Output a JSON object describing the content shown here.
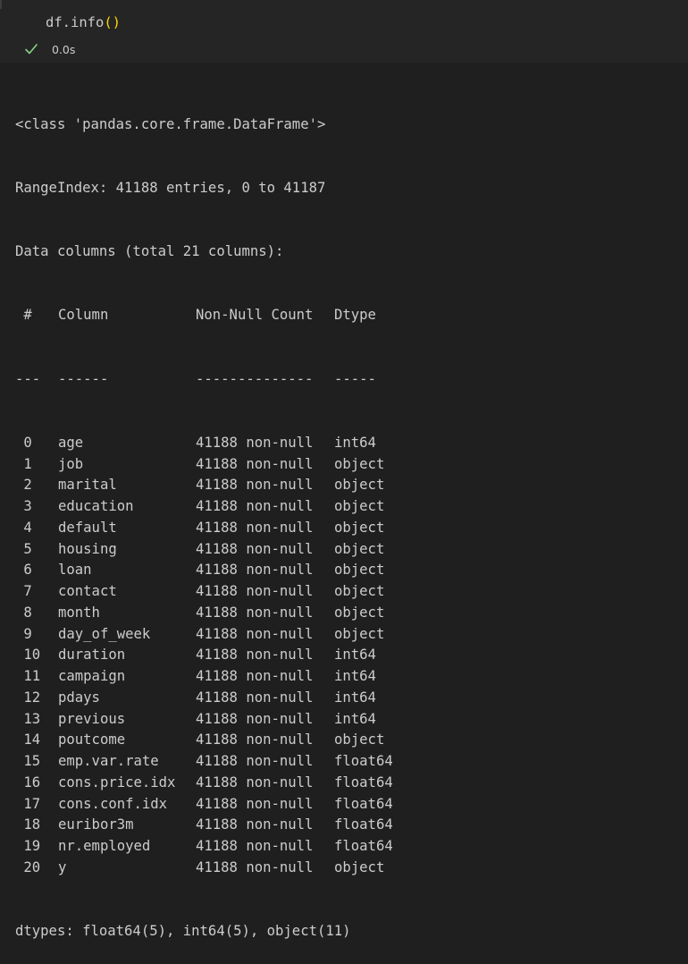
{
  "cell": {
    "code_prefix": "df.info",
    "code_parens": "()",
    "status_icon": "check-icon",
    "status_color": "#89d185",
    "exec_time": "0.0s"
  },
  "output": {
    "class_line": "<class 'pandas.core.frame.DataFrame'>",
    "range_index_line": "RangeIndex: 41188 entries, 0 to 41187",
    "columns_summary": "Data columns (total 21 columns):",
    "headers": {
      "idx": " #",
      "name": "Column",
      "count": "Non-Null Count",
      "dtype": "Dtype"
    },
    "separators": {
      "idx": "---",
      "name": "------",
      "count": "--------------",
      "dtype": "-----"
    },
    "rows": [
      {
        "idx": " 0",
        "name": "age",
        "count": "41188 non-null",
        "dtype": "int64"
      },
      {
        "idx": " 1",
        "name": "job",
        "count": "41188 non-null",
        "dtype": "object"
      },
      {
        "idx": " 2",
        "name": "marital",
        "count": "41188 non-null",
        "dtype": "object"
      },
      {
        "idx": " 3",
        "name": "education",
        "count": "41188 non-null",
        "dtype": "object"
      },
      {
        "idx": " 4",
        "name": "default",
        "count": "41188 non-null",
        "dtype": "object"
      },
      {
        "idx": " 5",
        "name": "housing",
        "count": "41188 non-null",
        "dtype": "object"
      },
      {
        "idx": " 6",
        "name": "loan",
        "count": "41188 non-null",
        "dtype": "object"
      },
      {
        "idx": " 7",
        "name": "contact",
        "count": "41188 non-null",
        "dtype": "object"
      },
      {
        "idx": " 8",
        "name": "month",
        "count": "41188 non-null",
        "dtype": "object"
      },
      {
        "idx": " 9",
        "name": "day_of_week",
        "count": "41188 non-null",
        "dtype": "object"
      },
      {
        "idx": " 10",
        "name": "duration",
        "count": "41188 non-null",
        "dtype": "int64"
      },
      {
        "idx": " 11",
        "name": "campaign",
        "count": "41188 non-null",
        "dtype": "int64"
      },
      {
        "idx": " 12",
        "name": "pdays",
        "count": "41188 non-null",
        "dtype": "int64"
      },
      {
        "idx": " 13",
        "name": "previous",
        "count": "41188 non-null",
        "dtype": "int64"
      },
      {
        "idx": " 14",
        "name": "poutcome",
        "count": "41188 non-null",
        "dtype": "object"
      },
      {
        "idx": " 15",
        "name": "emp.var.rate",
        "count": "41188 non-null",
        "dtype": "float64"
      },
      {
        "idx": " 16",
        "name": "cons.price.idx",
        "count": "41188 non-null",
        "dtype": "float64"
      },
      {
        "idx": " 17",
        "name": "cons.conf.idx",
        "count": "41188 non-null",
        "dtype": "float64"
      },
      {
        "idx": " 18",
        "name": "euribor3m",
        "count": "41188 non-null",
        "dtype": "float64"
      },
      {
        "idx": " 19",
        "name": "nr.employed",
        "count": "41188 non-null",
        "dtype": "float64"
      },
      {
        "idx": " 20",
        "name": "y",
        "count": "41188 non-null",
        "dtype": "object"
      }
    ],
    "dtypes_line": "dtypes: float64(5), int64(5), object(11)"
  }
}
